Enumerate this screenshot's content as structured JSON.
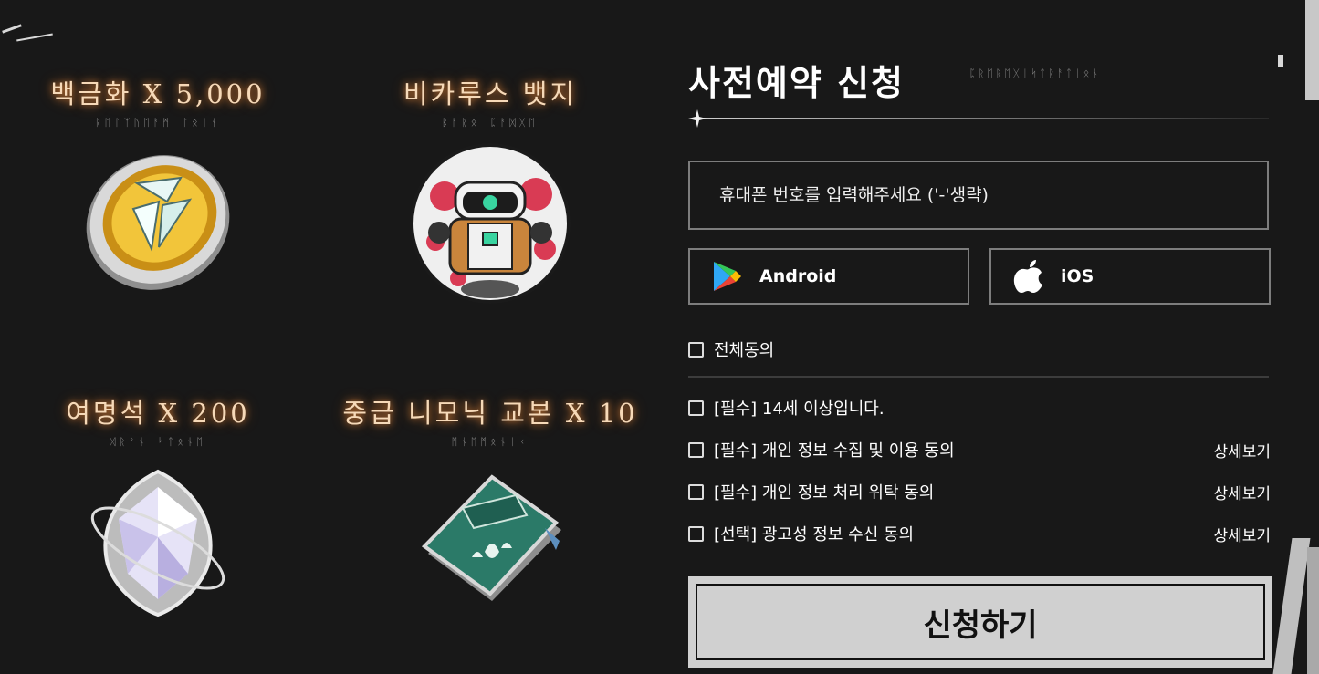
{
  "rewards": [
    {
      "title": "백금화 X 5,000",
      "rune": "ᚱᛖᛚᛉᚢᛖᚨᛗ ᛚᛟᛁᚾ",
      "icon": "platinum-coin-icon"
    },
    {
      "title": "비카루스 뱃지",
      "rune": "ᛒᚨᚱᛟ ᛈᚨᛞᚷᛖ",
      "icon": "vicarus-badge-icon"
    },
    {
      "title": "여명석 X 200",
      "rune": "ᛞᚱᚨᚾ ᛋᛏᛟᚾᛖ",
      "icon": "dawn-stone-icon"
    },
    {
      "title": "중급 니모닉 교본 X 10",
      "rune": "ᛗᚾᛖᛗᛟᚾᛁᚲ",
      "icon": "mnemonic-book-icon"
    }
  ],
  "form": {
    "title": "사전예약 신청",
    "title_rune": "ᛈᚱᛖᚱᛖᚷᛁᛋᛏᚱᚨᛏᛁᛟᚾ",
    "phone_placeholder": "휴대폰 번호를 입력해주세요 ('-'생략)",
    "android_label": "Android",
    "ios_label": "iOS",
    "agree_all": "전체동의",
    "agreements": [
      {
        "label": "[필수] 14세 이상입니다.",
        "detail": ""
      },
      {
        "label": "[필수] 개인 정보 수집 및 이용 동의",
        "detail": "상세보기"
      },
      {
        "label": "[필수] 개인 정보 처리 위탁 동의",
        "detail": "상세보기"
      },
      {
        "label": "[선택] 광고성 정보 수신 동의",
        "detail": "상세보기"
      }
    ],
    "submit_label": "신청하기"
  },
  "colors": {
    "background": "#181818",
    "reward_title": "#f6d9b8",
    "reward_glow": "#ff9640",
    "border": "#7d7d7d",
    "submit_bg": "#d0d0d0"
  }
}
